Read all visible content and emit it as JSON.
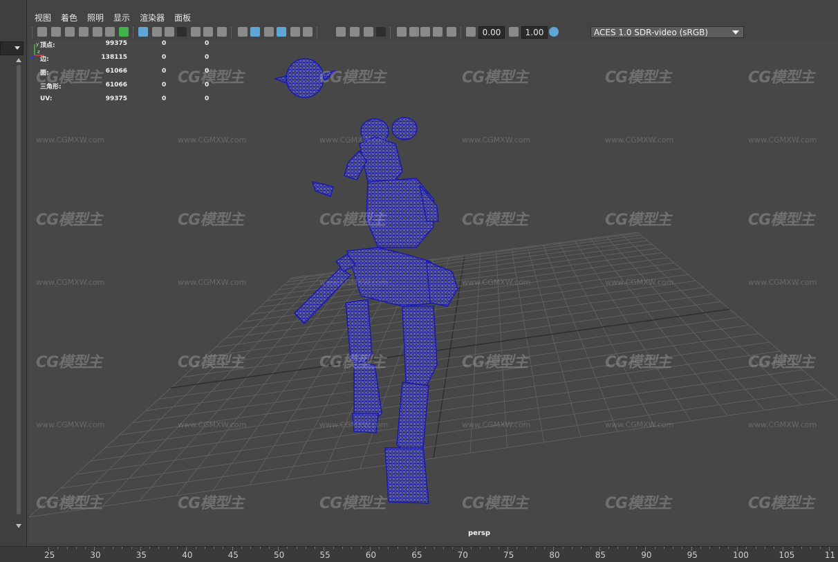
{
  "menu": [
    "视图",
    "着色",
    "照明",
    "显示",
    "渲染器",
    "面板"
  ],
  "toolbar": {
    "exposure_value": "0.00",
    "gamma_value": "1.00",
    "color_space": "ACES 1.0 SDR-video (sRGB)",
    "colors": {
      "highlight": "#5fa5d6",
      "accent_green": "#3fb24a"
    }
  },
  "hud": [
    {
      "label": "顶点:",
      "v1": "99375",
      "v2": "0",
      "v3": "0"
    },
    {
      "label": "边:",
      "v1": "138115",
      "v2": "0",
      "v3": "0"
    },
    {
      "label": "面:",
      "v1": "61066",
      "v2": "0",
      "v3": "0"
    },
    {
      "label": "三角形:",
      "v1": "61066",
      "v2": "0",
      "v3": "0"
    },
    {
      "label": "UV:",
      "v1": "99375",
      "v2": "0",
      "v3": "0"
    }
  ],
  "watermark": {
    "logo": "CG模型主",
    "url": "www.CGMXW.com"
  },
  "camera_label": "persp",
  "axis_labels": {
    "y": "y",
    "z": "z",
    "x": "x"
  },
  "timeline_ticks": [
    "25",
    "30",
    "35",
    "40",
    "45",
    "50",
    "55",
    "60",
    "65",
    "70",
    "75",
    "80",
    "85",
    "90",
    "95",
    "100",
    "105",
    "11"
  ],
  "wireframe_color": "#1a1ab0"
}
